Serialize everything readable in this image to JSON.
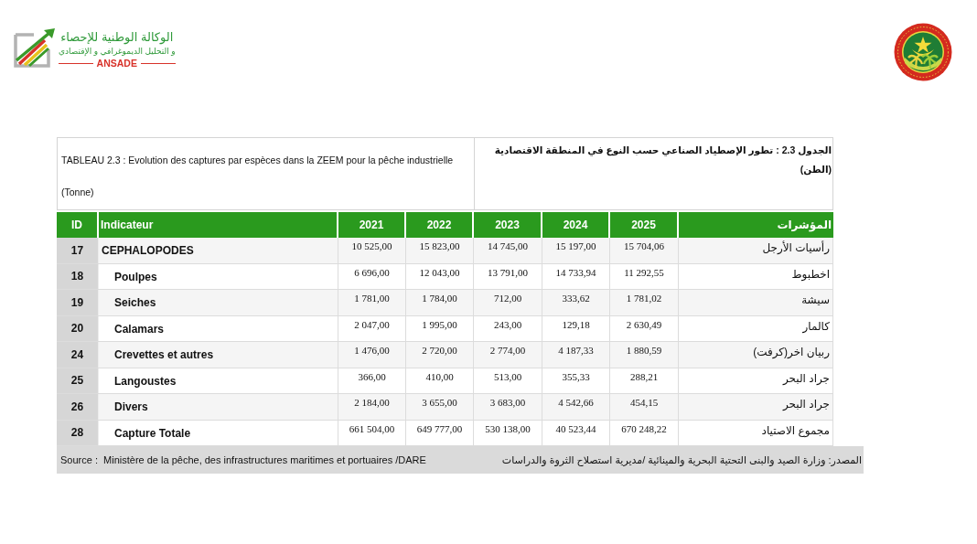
{
  "header": {
    "logo": {
      "title": "الوكالة الوطنية للإحصاء",
      "subtitle": "و التحليل الديموغرافي و الإقتصادي",
      "acronym": "ANSADE"
    }
  },
  "table": {
    "title_fr": "TABLEAU 2.3 : Evolution des captures par espèces dans la ZEEM pour la pêche industrielle",
    "unit_fr": "(Tonne)",
    "title_ar": "الجدول 2.3 : تطور الإصطياد الصناعي حسب النوع في المنطقة الاقتصادية",
    "unit_ar": "(الطن)",
    "columns": [
      "ID",
      "Indicateur",
      "2021",
      "2022",
      "2023",
      "2024",
      "2025",
      "المؤشرات"
    ],
    "rows": [
      {
        "id": "17",
        "kind": "group",
        "label": "CEPHALOPODES",
        "values": [
          "10 525,00",
          "15 823,00",
          "14 745,00",
          "15 197,00",
          "15 704,06"
        ],
        "label_ar": "رأسيات الأرجل"
      },
      {
        "id": "18",
        "kind": "item",
        "label": "Poulpes",
        "values": [
          "6 696,00",
          "12 043,00",
          "13 791,00",
          "14 733,94",
          "11 292,55"
        ],
        "label_ar": "اخطبوط"
      },
      {
        "id": "19",
        "kind": "item",
        "label": "Seiches",
        "values": [
          "1 781,00",
          "1 784,00",
          "712,00",
          "333,62",
          "1 781,02"
        ],
        "label_ar": "سيشة"
      },
      {
        "id": "20",
        "kind": "item",
        "label": "Calamars",
        "values": [
          "2 047,00",
          "1 995,00",
          "243,00",
          "129,18",
          "2 630,49"
        ],
        "label_ar": "كالمار"
      },
      {
        "id": "24",
        "kind": "item",
        "label": "Crevettes et autres",
        "values": [
          "1 476,00",
          "2 720,00",
          "2 774,00",
          "4 187,33",
          "1 880,59"
        ],
        "label_ar": "ربيان اخر(كرفت)"
      },
      {
        "id": "25",
        "kind": "item",
        "label": "Langoustes",
        "values": [
          "366,00",
          "410,00",
          "513,00",
          "355,33",
          "288,21"
        ],
        "label_ar": "جراد البحر"
      },
      {
        "id": "26",
        "kind": "item",
        "label": "Divers",
        "values": [
          "2 184,00",
          "3 655,00",
          "3 683,00",
          "4 542,66",
          "454,15"
        ],
        "label_ar": "جراد البحر"
      },
      {
        "id": "28",
        "kind": "item",
        "label": "Capture Totale",
        "values": [
          "661 504,00",
          "649 777,00",
          "530 138,00",
          "40 523,44",
          "670 248,22"
        ],
        "label_ar": "مجموع الاصتياد"
      }
    ]
  },
  "source": {
    "fr": "Source :  Ministère de la pêche, des infrastructures maritimes et portuaires /DARE",
    "ar": "المصدر: وزارة الصيد والبنى التحتية البحرية والمينائية /مديرية استصلاح الثروة والدراسات"
  }
}
